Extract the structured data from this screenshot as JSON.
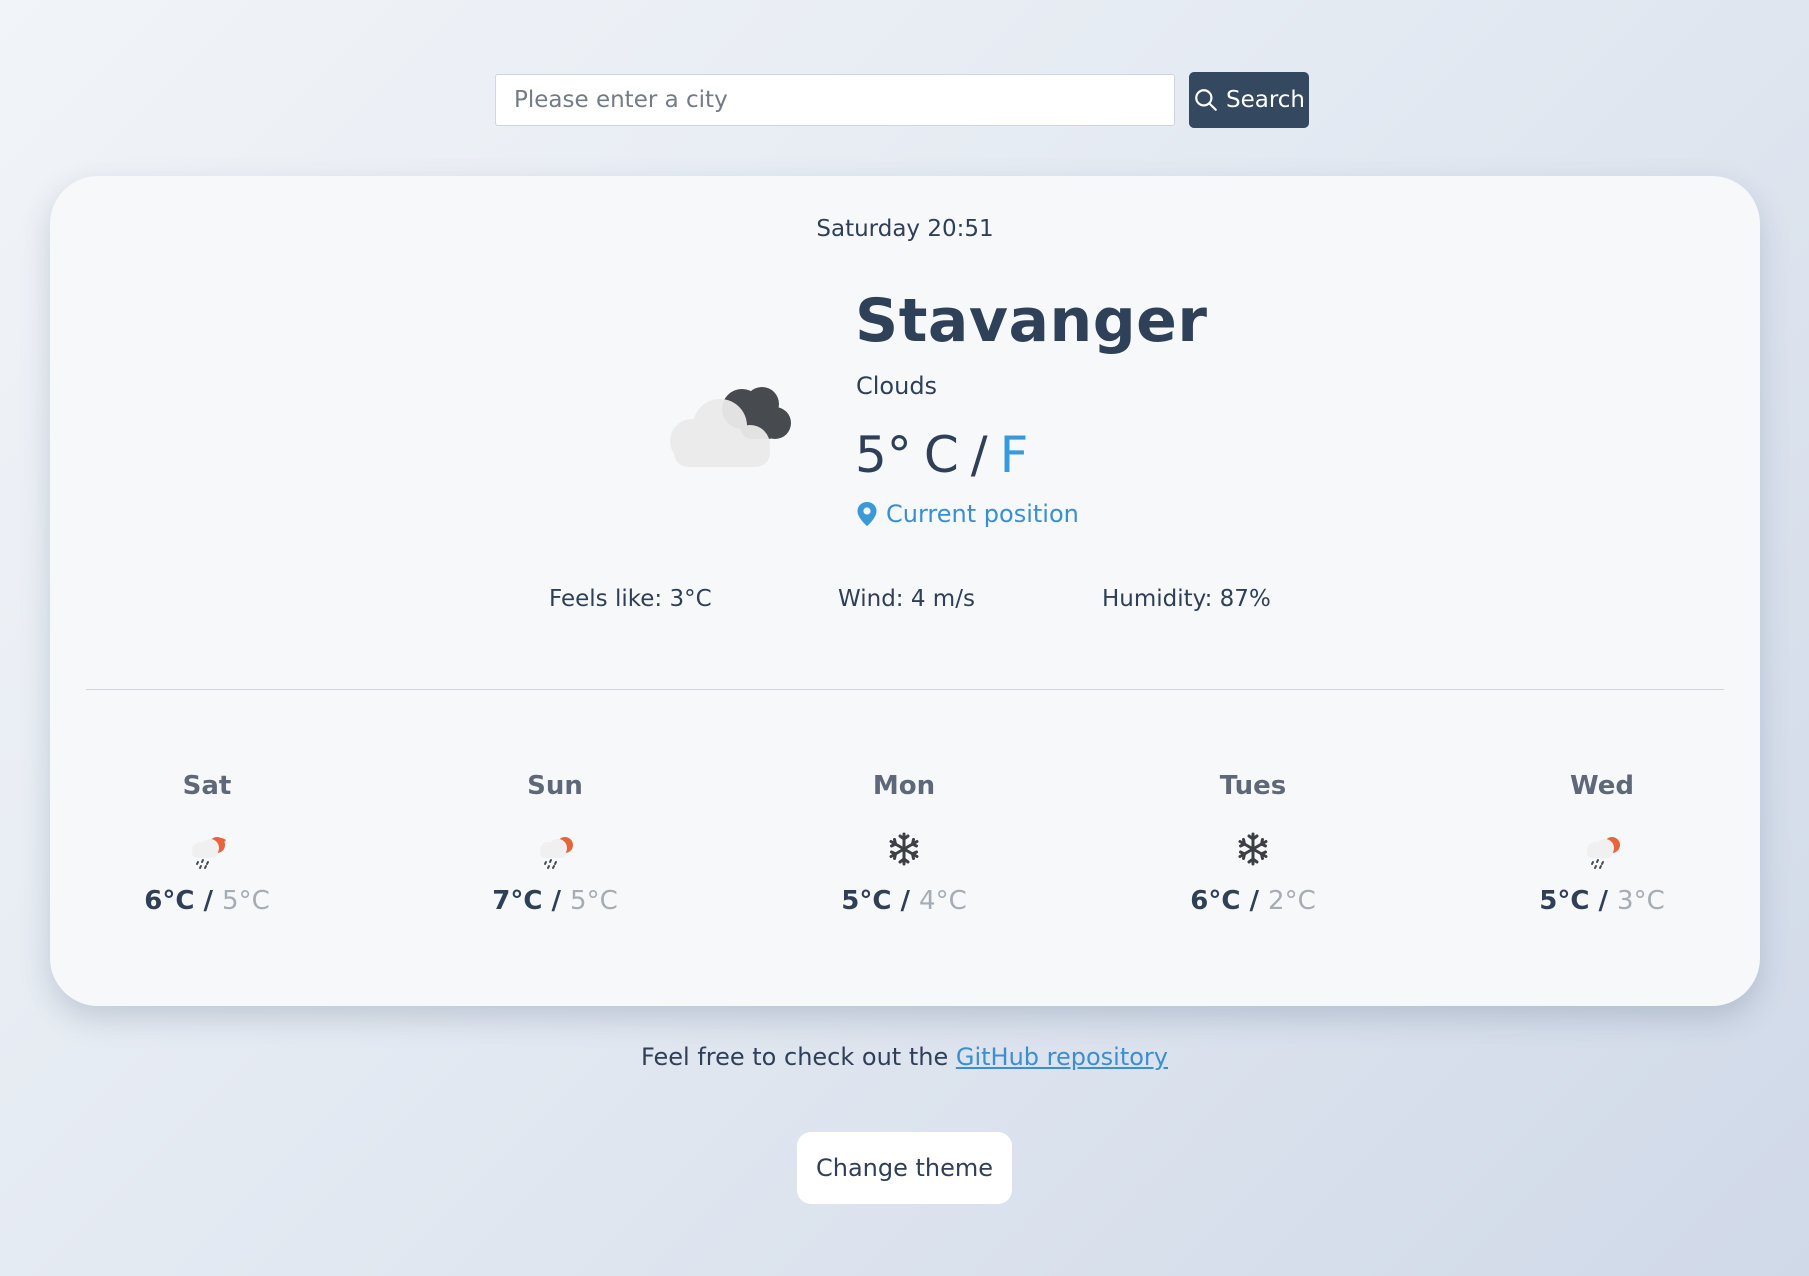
{
  "search": {
    "placeholder": "Please enter a city",
    "value": "",
    "button_label": "Search"
  },
  "current": {
    "datetime": "Saturday 20:51",
    "city": "Stavanger",
    "condition": "Clouds",
    "icon": "night-cloud-icon",
    "temperature": "5°",
    "unit_c": "C",
    "unit_separator": "/",
    "unit_f": "F",
    "location_label": "Current position",
    "feels_like": "Feels like: 3°C",
    "wind": "Wind: 4 m/s",
    "humidity": "Humidity: 87%"
  },
  "forecast": [
    {
      "day": "Sat",
      "icon": "sun-rain-icon",
      "max": "6°C",
      "sep": " / ",
      "min": "5°C"
    },
    {
      "day": "Sun",
      "icon": "sun-rain-icon",
      "max": "7°C",
      "sep": " / ",
      "min": "5°C"
    },
    {
      "day": "Mon",
      "icon": "snowflake-icon",
      "max": "5°C",
      "sep": " / ",
      "min": "4°C"
    },
    {
      "day": "Tues",
      "icon": "snowflake-icon",
      "max": "6°C",
      "sep": " / ",
      "min": "2°C"
    },
    {
      "day": "Wed",
      "icon": "sun-rain-icon",
      "max": "5°C",
      "sep": " / ",
      "min": "3°C"
    }
  ],
  "footer": {
    "text": "Feel free to check out the ",
    "link_label": "GitHub repository",
    "theme_button_label": "Change theme"
  },
  "colors": {
    "accent": "#3a8fd0",
    "button_dark": "#34485f",
    "text": "#2f3f57",
    "muted": "#a6acb4"
  }
}
